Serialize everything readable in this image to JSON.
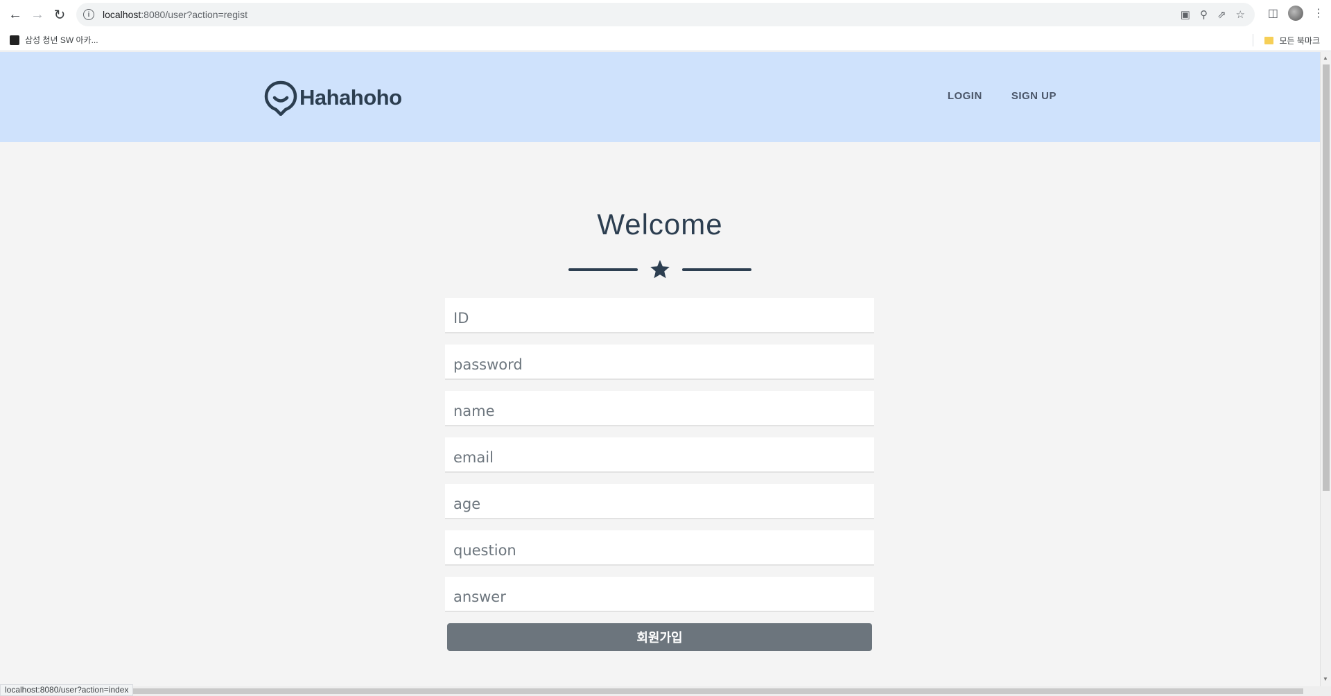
{
  "browser": {
    "url_host": "localhost",
    "url_rest": ":8080/user?action=regist",
    "bookmark_item": "삼성 청년 SW 아카...",
    "bookmarks_folder": "모든 북마크",
    "status_url": "localhost:8080/user?action=index"
  },
  "header": {
    "logo_text": "Hahahoho",
    "nav": {
      "login": "LOGIN",
      "signup": "SIGN UP"
    }
  },
  "main": {
    "title": "Welcome",
    "fields": {
      "id": "ID",
      "password": "password",
      "name": "name",
      "email": "email",
      "age": "age",
      "question": "question",
      "answer": "answer"
    },
    "submit_label": "회원가입"
  },
  "colors": {
    "header_bg": "#cfe2fc",
    "accent": "#2c3e50",
    "button": "#6c757d"
  }
}
